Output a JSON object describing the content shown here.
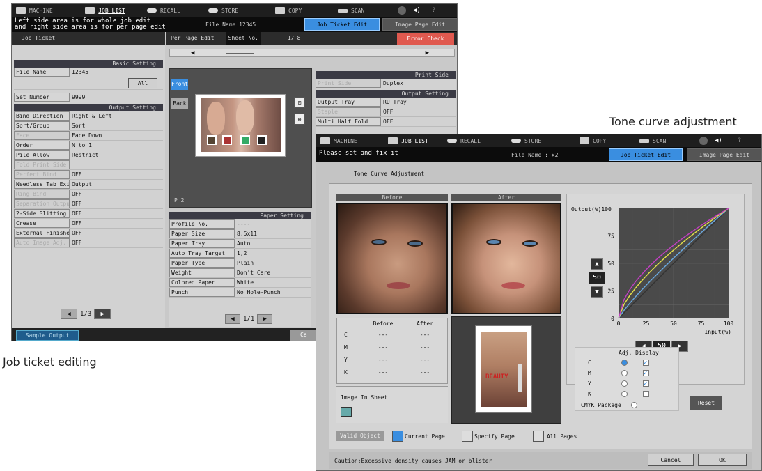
{
  "captions": {
    "job_ticket": "Job ticket editing",
    "tone_curve": "Tone curve adjustment"
  },
  "screen1": {
    "tabs": [
      "MACHINE",
      "JOB LIST",
      "RECALL",
      "STORE",
      "COPY",
      "SCAN"
    ],
    "help": "?",
    "message_line1": "Left side area is for whole job edit",
    "message_line2": "and right side area is for per page edit",
    "file_name": "File Name  12345",
    "job_ticket_edit": "Job Ticket Edit",
    "image_page_edit": "Image Page Edit",
    "job_ticket_title": "Job Ticket",
    "per_page_edit": "Per Page Edit",
    "sheet_no_label": "Sheet No.",
    "sheet_no_value": "1/",
    "sheet_total": "8",
    "error_check": "Error Check",
    "basic_setting": "Basic Setting",
    "file_name_label": "File Name",
    "file_name_value": "12345",
    "all_button": "All",
    "set_number_label": "Set Number",
    "set_number_value": "9999",
    "output_setting": "Output Setting",
    "output_rows": [
      {
        "label": "Bind Direction",
        "value": "Right & Left"
      },
      {
        "label": "Sort/Group",
        "value": "Sort"
      },
      {
        "label": "Face",
        "value": "Face Down"
      },
      {
        "label": "Order",
        "value": "N to 1"
      },
      {
        "label": "Pile Allow",
        "value": "Restrict"
      },
      {
        "label": "Fold Print Side",
        "value": ""
      },
      {
        "label": "Perfect Bind",
        "value": "OFF"
      },
      {
        "label": "Needless Tab Exit",
        "value": "Output"
      },
      {
        "label": "Ring Bind",
        "value": "OFF"
      },
      {
        "label": "Separation Output",
        "value": "OFF"
      },
      {
        "label": "2-Side Slitting",
        "value": "OFF"
      },
      {
        "label": "Crease",
        "value": "OFF"
      },
      {
        "label": "External Finisher",
        "value": "OFF"
      },
      {
        "label": "Auto Image Adj.",
        "value": "OFF"
      }
    ],
    "page_left": "1/3",
    "sample_output": "Sample Output",
    "cancel_partial": "Ca",
    "front": "Front",
    "back": "Back",
    "page_marker": "P  2",
    "print_side_header": "Print Side",
    "print_side_label": "Print Side",
    "print_side_value": "Duplex",
    "output_setting2": "Output Setting",
    "right_rows": [
      {
        "label": "Output Tray",
        "value": "RU Tray"
      },
      {
        "label": "Staple",
        "value": "OFF"
      },
      {
        "label": "Multi Half Fold",
        "value": "OFF"
      }
    ],
    "paper_setting": "Paper Setting",
    "paper_rows": [
      {
        "label": "Profile No.",
        "value": "----"
      },
      {
        "label": "Paper Size",
        "value": "8.5x11"
      },
      {
        "label": "Paper Tray",
        "value": "Auto"
      },
      {
        "label": "Auto Tray Target",
        "value": "1,2"
      },
      {
        "label": "Paper Type",
        "value": "Plain"
      },
      {
        "label": "Weight",
        "value": "Don't Care"
      },
      {
        "label": "Colored Paper",
        "value": "White"
      },
      {
        "label": "Punch",
        "value": "No Hole-Punch"
      }
    ],
    "page_right": "1/1"
  },
  "screen2": {
    "tabs": [
      "MACHINE",
      "JOB LIST",
      "RECALL",
      "STORE",
      "COPY",
      "SCAN"
    ],
    "help": "?",
    "message": "Please set and fix it",
    "file_name": "File Name : x2",
    "job_ticket_edit": "Job Ticket Edit",
    "image_page_edit": "Image Page Edit",
    "title": "Tone Curve Adjustment",
    "before": "Before",
    "after": "After",
    "table_before": "Before",
    "table_after": "After",
    "table_rows": [
      {
        "ch": "C",
        "before": "---",
        "after": "---"
      },
      {
        "ch": "M",
        "before": "---",
        "after": "---"
      },
      {
        "ch": "Y",
        "before": "---",
        "after": "---"
      },
      {
        "ch": "K",
        "before": "---",
        "after": "---"
      }
    ],
    "image_in_sheet": "Image In Sheet",
    "output_label": "Output(%)",
    "y_ticks": [
      "100",
      "75",
      "50",
      "25",
      "0"
    ],
    "x_ticks": [
      "0",
      "25",
      "50",
      "75",
      "100"
    ],
    "input_label": "Input(%)",
    "output_value": "50",
    "input_value": "50",
    "adj_display": "Adj. Display",
    "adj_rows": [
      {
        "ch": "C",
        "adj": true,
        "disp": true
      },
      {
        "ch": "M",
        "adj": false,
        "disp": true
      },
      {
        "ch": "Y",
        "adj": false,
        "disp": true
      },
      {
        "ch": "K",
        "adj": false,
        "disp": false
      }
    ],
    "cmyk_package": "CMYK Package",
    "reset": "Reset",
    "valid_object": "Valid Object",
    "current_page": "Current Page",
    "specify_page": "Specify Page",
    "all_pages": "All Pages",
    "caution": "Caution:Excessive density causes JAM or blister",
    "cancel": "Cancel",
    "ok": "OK",
    "poster_text": "BEAUTY",
    "curve_colors": {
      "c": "#6aa9e0",
      "m": "#c23fc2",
      "y": "#e7e24a",
      "k": "#333333"
    }
  }
}
